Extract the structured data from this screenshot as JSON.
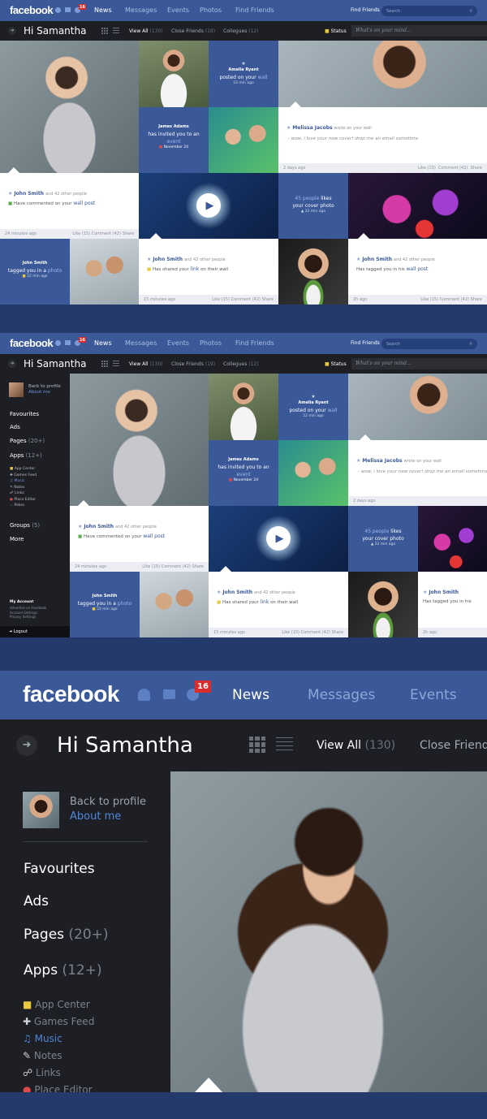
{
  "brand": "facebook",
  "nav": {
    "news": "News",
    "messages": "Messages",
    "events": "Events",
    "photos": "Photos",
    "find_friends": "Find Friends"
  },
  "notification_count": "16",
  "find_friends_label": "Find Friends",
  "search_placeholder": "Search",
  "greeting": "Hi Samantha",
  "filters": {
    "view_all": "View All",
    "view_all_count": "(130)",
    "close_friends": "Close Friends",
    "close_friends_count": "(19)",
    "collegues": "Collegues",
    "collegues_count": "(12)"
  },
  "status": {
    "label": "Status",
    "placeholder": "What's on your mind..."
  },
  "sidebar": {
    "back": "Back to profile",
    "about": "About me",
    "favourites": "Favourites",
    "ads": "Ads",
    "pages": "Pages",
    "pages_count": "(20+)",
    "apps": "Apps",
    "apps_count": "(12+)",
    "apps_list": [
      "App Center",
      "Games Feed",
      "Music",
      "Notes",
      "Links",
      "Place Editor",
      "Pokes"
    ],
    "groups": "Groups",
    "groups_count": "(5)",
    "more": "More",
    "account_title": "My Account",
    "account_items": [
      "Advertise on Facebook",
      "Account Settings",
      "Privacy Settings"
    ],
    "logout": "Logout"
  },
  "posts": {
    "amelia": {
      "name": "Amelia Ryant",
      "text": "posted on your",
      "link": "wall",
      "time": "22 min ago"
    },
    "james": {
      "name": "James Adams",
      "text": "has invited you to an",
      "link": "event",
      "date": "November 24"
    },
    "melissa": {
      "name": "Melissa Jacobs",
      "meta": "wrote on your wall",
      "text": "- wow, i love your new cover! drop me an email sometime.",
      "time": "2 days ago",
      "like": "Like (15)",
      "comment": "Comment (42)",
      "share": "Share"
    },
    "john1": {
      "name": "John Smith",
      "meta": "and 42 other people",
      "text": "Have commented on your",
      "link": "wall post",
      "time": "24 minutes ago",
      "like": "Like (15)",
      "comment": "Comment (42)",
      "share": "Share"
    },
    "cover": {
      "link": "45 people",
      "text1": "likes",
      "text2": "your cover photo",
      "time": "22 min ago"
    },
    "john2": {
      "name": "John Smith",
      "text": "tagged you in a",
      "link": "photo",
      "time": "22 min ago"
    },
    "john3": {
      "name": "John Smith",
      "meta": "and 42 other people",
      "text": "Has shared your",
      "link": "link",
      "text2": "on their wall",
      "time": "15 minutes ago",
      "like": "Like (15)",
      "comment": "Comment (42)",
      "share": "Share"
    },
    "john4": {
      "name": "John Smith",
      "meta": "and 42 other people",
      "text": "Has tagged you in his",
      "link": "wall post",
      "time": "2h ago",
      "like": "Like (15)",
      "comment": "Comment (42)",
      "share": "Share"
    }
  }
}
